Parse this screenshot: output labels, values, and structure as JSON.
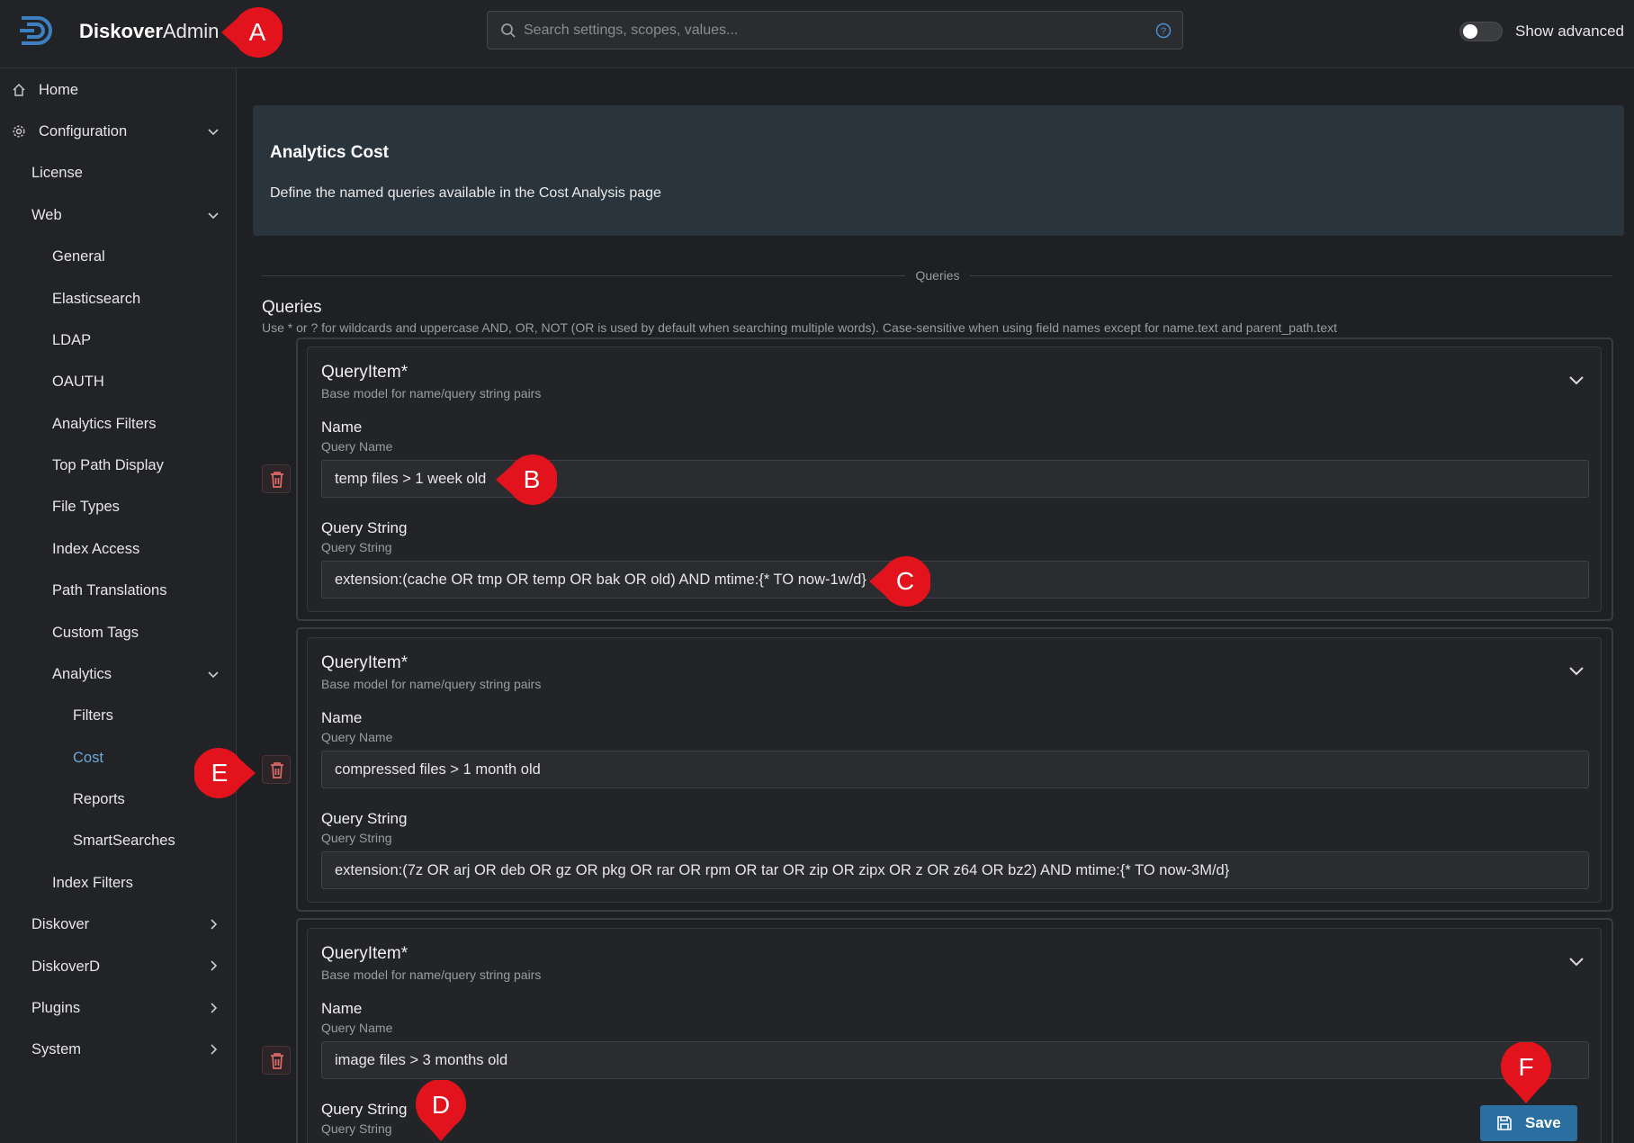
{
  "header": {
    "brand_bold": "Diskover",
    "brand_light": "Admin",
    "search_placeholder": "Search settings, scopes, values...",
    "show_advanced_label": "Show advanced",
    "show_advanced_on": false
  },
  "sidebar": {
    "items": [
      {
        "label": "Home",
        "icon": "home-icon"
      },
      {
        "label": "Configuration",
        "icon": "gear-icon",
        "expanded": true
      },
      {
        "label": "License"
      },
      {
        "label": "Web",
        "expanded": true
      },
      {
        "label": "General"
      },
      {
        "label": "Elasticsearch"
      },
      {
        "label": "LDAP"
      },
      {
        "label": "OAUTH"
      },
      {
        "label": "Analytics Filters"
      },
      {
        "label": "Top Path Display"
      },
      {
        "label": "File Types"
      },
      {
        "label": "Index Access"
      },
      {
        "label": "Path Translations"
      },
      {
        "label": "Custom Tags"
      },
      {
        "label": "Analytics",
        "expanded": true
      },
      {
        "label": "Filters"
      },
      {
        "label": "Cost",
        "active": true
      },
      {
        "label": "Reports"
      },
      {
        "label": "SmartSearches"
      },
      {
        "label": "Index Filters"
      },
      {
        "label": "Diskover",
        "expanded": false
      },
      {
        "label": "DiskoverD",
        "expanded": false
      },
      {
        "label": "Plugins",
        "expanded": false
      },
      {
        "label": "System",
        "expanded": false
      }
    ]
  },
  "main": {
    "title": "Analytics Cost",
    "description": "Define the named queries available in the Cost Analysis page",
    "divider_label": "Queries",
    "section_title": "Queries",
    "section_help": "Use * or ? for wildcards and uppercase AND, OR, NOT (OR is used by default when searching multiple words). Case-sensitive when using field names except for name.text and parent_path.text",
    "query_items": [
      {
        "title": "QueryItem*",
        "subtitle": "Base model for name/query string pairs",
        "name_label": "Name",
        "name_sub": "Query Name",
        "name_value": "temp files > 1 week old",
        "query_label": "Query String",
        "query_sub": "Query String",
        "query_value": "extension:(cache OR tmp OR temp OR bak OR old) AND mtime:{* TO now-1w/d}"
      },
      {
        "title": "QueryItem*",
        "subtitle": "Base model for name/query string pairs",
        "name_label": "Name",
        "name_sub": "Query Name",
        "name_value": "compressed files > 1 month old",
        "query_label": "Query String",
        "query_sub": "Query String",
        "query_value": "extension:(7z OR arj OR deb OR gz OR pkg OR rar OR rpm OR tar OR zip OR zipx OR z OR z64 OR bz2) AND mtime:{* TO now-3M/d}"
      },
      {
        "title": "QueryItem*",
        "subtitle": "Base model for name/query string pairs",
        "name_label": "Name",
        "name_sub": "Query Name",
        "name_value": "image files > 3 months old",
        "query_label": "Query String",
        "query_sub": "Query String"
      }
    ],
    "save_label": "Save"
  },
  "annotations": [
    "A",
    "B",
    "C",
    "D",
    "E",
    "F"
  ],
  "colors": {
    "accent": "#2a6fa0",
    "active_nav": "#6fa8d6",
    "marker": "#e2131d",
    "trash": "#e06a6a"
  }
}
